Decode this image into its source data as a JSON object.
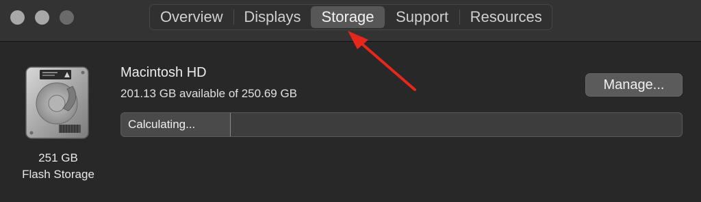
{
  "window": {
    "tabs": [
      {
        "label": "Overview"
      },
      {
        "label": "Displays"
      },
      {
        "label": "Storage",
        "selected": true
      },
      {
        "label": "Support"
      },
      {
        "label": "Resources"
      }
    ]
  },
  "storage": {
    "disk_icon": "hard-drive-icon",
    "capacity": "251 GB",
    "type": "Flash Storage",
    "volume_name": "Macintosh HD",
    "available_text": "201.13 GB available of 250.69 GB",
    "manage_label": "Manage...",
    "progress_label": "Calculating...",
    "progress_fraction": 0.195
  },
  "annotation": {
    "arrow_color": "#e8271c"
  }
}
